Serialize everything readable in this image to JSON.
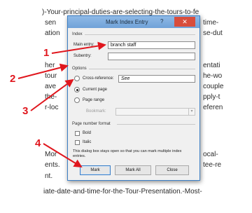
{
  "document": {
    "lines_left": [
      ")-Your-principal-duties-are-selecting-the-tours-to-fe",
      "sen",
      "ation",
      "",
      "",
      "",
      "",
      "",
      "",
      "",
      "",
      "",
      "",
      "",
      "",
      "",
      "",
      "",
      "",
      "ents.",
      "",
      "",
      "",
      "iate-date-and-time-for-the-Tour-Presentation.-Most-"
    ],
    "right_fragments": [
      "time-",
      "se-dut",
      "entati",
      "he-wo",
      "couple",
      "pply-t",
      "eferen",
      "ocal-",
      "tee-re"
    ],
    "left_fragments": [
      "sen",
      "ation",
      "",
      "her",
      "tour",
      "ave",
      "the-",
      "r-loc",
      "Mor",
      "ents.",
      "nt."
    ],
    "bottom_line": "iate-date-and-time-for-the-Tour-Presentation.-Most-"
  },
  "dialog": {
    "title": "Mark Index Entry",
    "help": "?",
    "close": "✕",
    "index_section": "Index",
    "main_entry_label": "Main entry:",
    "main_entry_value": "branch staff",
    "subentry_label": "Subentry:",
    "subentry_value": "",
    "options_section": "Options",
    "cross_reference_label": "Cross-reference:",
    "cross_reference_value": "See",
    "current_page_label": "Current page",
    "page_range_label": "Page range",
    "bookmark_label": "Bookmark:",
    "page_number_format_section": "Page number format",
    "bold_label": "Bold",
    "italic_label": "Italic",
    "note": "This dialog box stays open so that you can mark multiple index entries.",
    "buttons": {
      "mark": "Mark",
      "mark_all": "Mark All",
      "close": "Close"
    }
  },
  "annotations": {
    "color": "#e0161d",
    "numbers": [
      "1",
      "2",
      "3",
      "4"
    ]
  }
}
